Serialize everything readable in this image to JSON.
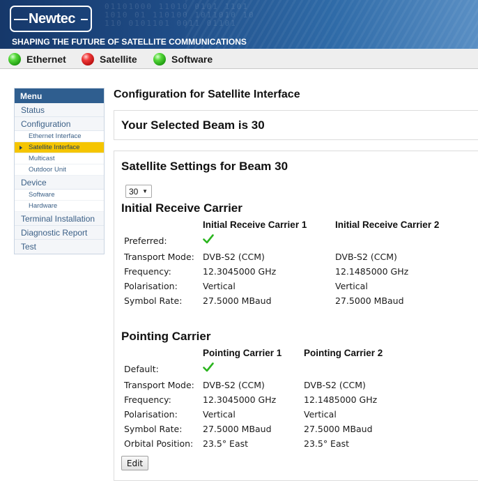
{
  "header": {
    "logo_text": "Newtec",
    "tagline": "SHAPING THE FUTURE OF SATELLITE COMMUNICATIONS"
  },
  "status_bar": [
    {
      "label": "Ethernet",
      "state_color": "#2fb81c"
    },
    {
      "label": "Satellite",
      "state_color": "#d41c1c"
    },
    {
      "label": "Software",
      "state_color": "#2fb81c"
    }
  ],
  "menu": {
    "title": "Menu",
    "items": [
      {
        "label": "Status"
      },
      {
        "label": "Configuration",
        "children": [
          "Ethernet Interface",
          "Satellite Interface",
          "Multicast",
          "Outdoor Unit"
        ],
        "active_child": "Satellite Interface"
      },
      {
        "label": "Device",
        "children": [
          "Software",
          "Hardware"
        ]
      },
      {
        "label": "Terminal Installation"
      },
      {
        "label": "Diagnostic Report"
      },
      {
        "label": "Test"
      }
    ]
  },
  "main": {
    "page_title": "Configuration for Satellite Interface",
    "selected_beam_text": "Your Selected Beam is 30",
    "settings_title": "Satellite Settings for Beam 30",
    "beam_select_value": "30",
    "receive": {
      "title": "Initial Receive Carrier",
      "col1": "Initial Receive Carrier 1",
      "col2": "Initial Receive Carrier 2",
      "rows": {
        "preferred": "Preferred:",
        "transport": {
          "label": "Transport Mode:",
          "v1": "DVB-S2 (CCM)",
          "v2": "DVB-S2 (CCM)"
        },
        "frequency": {
          "label": "Frequency:",
          "v1": "12.3045000 GHz",
          "v2": "12.1485000 GHz"
        },
        "polarisation": {
          "label": "Polarisation:",
          "v1": "Vertical",
          "v2": "Vertical"
        },
        "symbol_rate": {
          "label": "Symbol Rate:",
          "v1": "27.5000 MBaud",
          "v2": "27.5000 MBaud"
        }
      }
    },
    "pointing": {
      "title": "Pointing Carrier",
      "col1": "Pointing Carrier 1",
      "col2": "Pointing Carrier 2",
      "rows": {
        "default": "Default:",
        "transport": {
          "label": "Transport Mode:",
          "v1": "DVB-S2 (CCM)",
          "v2": "DVB-S2 (CCM)"
        },
        "frequency": {
          "label": "Frequency:",
          "v1": "12.3045000 GHz",
          "v2": "12.1485000 GHz"
        },
        "polarisation": {
          "label": "Polarisation:",
          "v1": "Vertical",
          "v2": "Vertical"
        },
        "symbol_rate": {
          "label": "Symbol Rate:",
          "v1": "27.5000 MBaud",
          "v2": "27.5000 MBaud"
        },
        "orbital": {
          "label": "Orbital Position:",
          "v1": "23.5° East",
          "v2": "23.5° East"
        }
      }
    },
    "edit_label": "Edit"
  },
  "colors": {
    "menu_header": "#2f5e8f",
    "active_menu_item": "#f5c500",
    "check_green": "#2bb51f"
  }
}
